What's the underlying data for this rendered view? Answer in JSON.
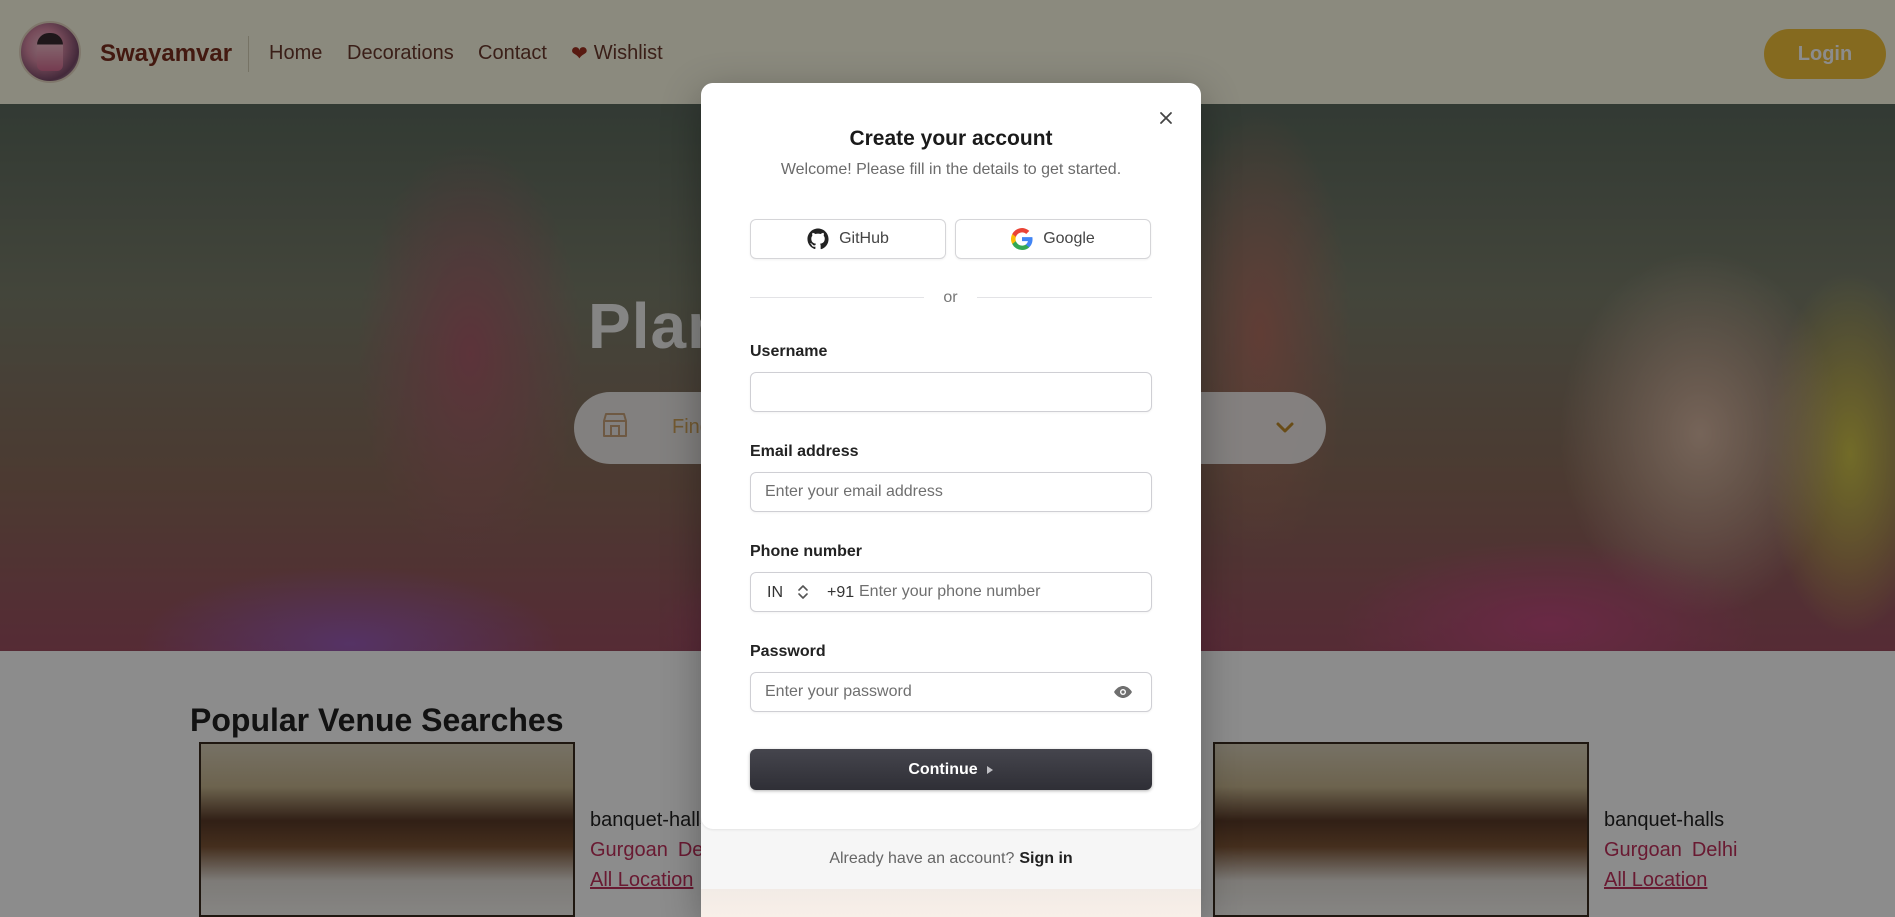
{
  "navbar": {
    "brand": "Swayamvar",
    "links": {
      "home": "Home",
      "decorations": "Decorations",
      "contact": "Contact",
      "wishlist": "Wishlist"
    },
    "login_label": "Login"
  },
  "hero": {
    "title": "Plan Your Wedding",
    "search_placeholder": "Find"
  },
  "section": {
    "title": "Popular Venue Searches",
    "cards": [
      {
        "category": "banquet-halls",
        "cities": [
          "Gurgoan",
          "Delhi"
        ],
        "all_location": "All Location"
      },
      {
        "category": "banquet-halls",
        "cities": [
          "Gurgoan",
          "Delhi"
        ],
        "all_location": "All Location"
      }
    ]
  },
  "modal": {
    "title": "Create your account",
    "subtitle": "Welcome! Please fill in the details to get started.",
    "social": {
      "github": "GitHub",
      "google": "Google"
    },
    "divider": "or",
    "fields": {
      "username": {
        "label": "Username",
        "value": "",
        "placeholder": ""
      },
      "email": {
        "label": "Email address",
        "value": "",
        "placeholder": "Enter your email address"
      },
      "phone": {
        "label": "Phone number",
        "country": "IN",
        "dial_code": "+91",
        "value": "",
        "placeholder": "Enter your phone number"
      },
      "password": {
        "label": "Password",
        "value": "",
        "placeholder": "Enter your password"
      }
    },
    "continue_label": "Continue",
    "footer": {
      "text": "Already have an account?",
      "signin": "Sign in"
    }
  },
  "colors": {
    "brand": "#7a2e1e",
    "login_button": "#f3c23a",
    "continue_button": "#2f2f36",
    "location_link": "#c0305c"
  },
  "icons": {
    "close": "close-icon",
    "github": "github-icon",
    "google": "google-icon",
    "phone_country": "chevron-up-down-icon",
    "password_toggle": "eye-icon",
    "continue": "caret-right-icon",
    "wishlist": "heart-icon",
    "hero_search": "store-icon",
    "hero_dropdown": "chevron-down-icon"
  }
}
